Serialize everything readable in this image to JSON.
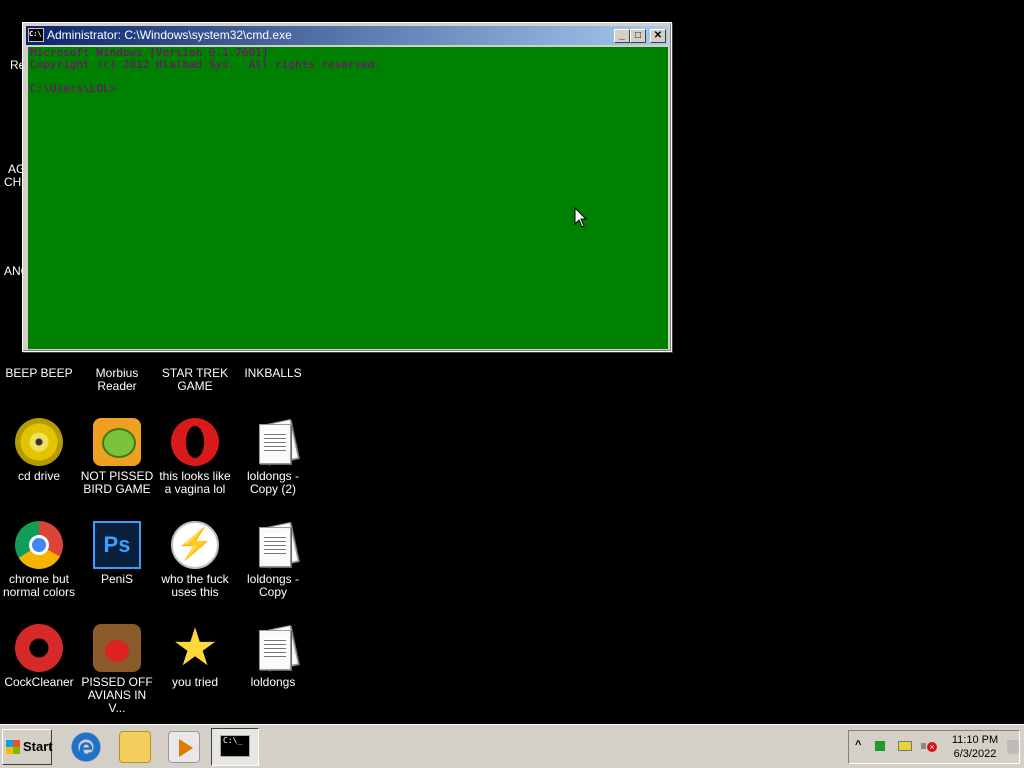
{
  "window": {
    "title": "Administrator: C:\\Windows\\system32\\cmd.exe",
    "title_icon_text": "C:\\",
    "minimize": "_",
    "maximize": "□",
    "close": "✕",
    "console_lines": [
      "Microsoft Windows [Version 6.1.7601]",
      "Copyright (c) 2012 Hlalbad Sys.  All rights reserved.",
      "",
      "C:\\Users\\LOL>"
    ],
    "console_bg": "#008000",
    "console_fg": "#800080"
  },
  "desktop": {
    "partial_labels": [
      "Re",
      "AG",
      "CHI",
      "ANC"
    ],
    "icons": [
      {
        "label": "BEEP BEEP"
      },
      {
        "label": "Morbius Reader"
      },
      {
        "label": "STAR TREK GAME"
      },
      {
        "label": "INKBALLS"
      },
      {
        "label": "cd drive",
        "icon": "cd-drive-icon"
      },
      {
        "label": "NOT PISSED BIRD GAME",
        "icon": "green-bird-icon"
      },
      {
        "label": "this looks like a vagina lol",
        "icon": "opera-icon"
      },
      {
        "label": "loldongs - Copy (2)",
        "icon": "text-document-icon"
      },
      {
        "label": "chrome but normal colors",
        "icon": "chrome-icon"
      },
      {
        "label": "PeniS",
        "icon": "photoshop-icon",
        "glyph": "Ps"
      },
      {
        "label": "who the fuck uses this",
        "icon": "lightning-icon",
        "glyph": "⚡"
      },
      {
        "label": "loldongs - Copy",
        "icon": "text-document-icon"
      },
      {
        "label": "CockCleaner",
        "icon": "ccleaner-icon"
      },
      {
        "label": "PISSED OFF AVIANS IN V...",
        "icon": "angry-birds-seasons-icon"
      },
      {
        "label": "you tried",
        "icon": "star-icon",
        "glyph": "★"
      },
      {
        "label": "loldongs",
        "icon": "text-document-icon"
      }
    ]
  },
  "taskbar": {
    "start_label": "Start",
    "ie_glyph": "e",
    "task_icon_text": "C:\\_",
    "tray_chevron": "^",
    "time": "11:10 PM",
    "date": "6/3/2022"
  }
}
